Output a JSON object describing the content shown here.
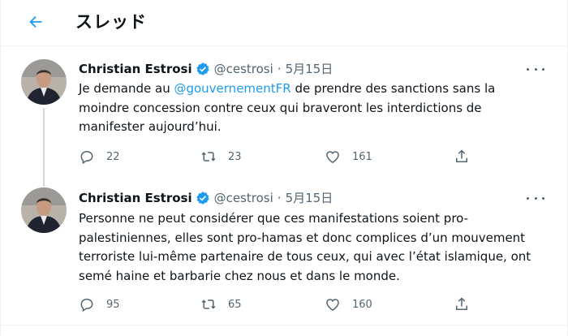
{
  "header": {
    "title": "スレッド",
    "back_icon": "arrow-left-icon"
  },
  "colors": {
    "accent": "#1d9bf0",
    "text": "#0f1419",
    "secondary": "#536471",
    "divider": "#eff3f4",
    "thread_line": "#cfd9de"
  },
  "tweets": [
    {
      "author": "Christian Estrosi",
      "handle": "@cestrosi",
      "separator": "·",
      "date": "5月15日",
      "text_before": "Je demande au ",
      "mention": "@gouvernementFR",
      "text_after": " de prendre des sanctions sans la moindre concession contre ceux qui braveront les interdictions de manifester aujourd’hui.",
      "replies": "22",
      "retweets": "23",
      "likes": "161"
    },
    {
      "author": "Christian Estrosi",
      "handle": "@cestrosi",
      "separator": "·",
      "date": "5月15日",
      "text": "Personne ne peut considérer que ces manifestations soient pro-palestiniennes, elles sont pro-hamas et donc complices d’un mouvement terroriste lui-même partenaire de tous ceux, qui avec l’état islamique, ont semé haine et barbarie chez nous et dans le monde.",
      "replies": "95",
      "retweets": "65",
      "likes": "160"
    }
  ]
}
